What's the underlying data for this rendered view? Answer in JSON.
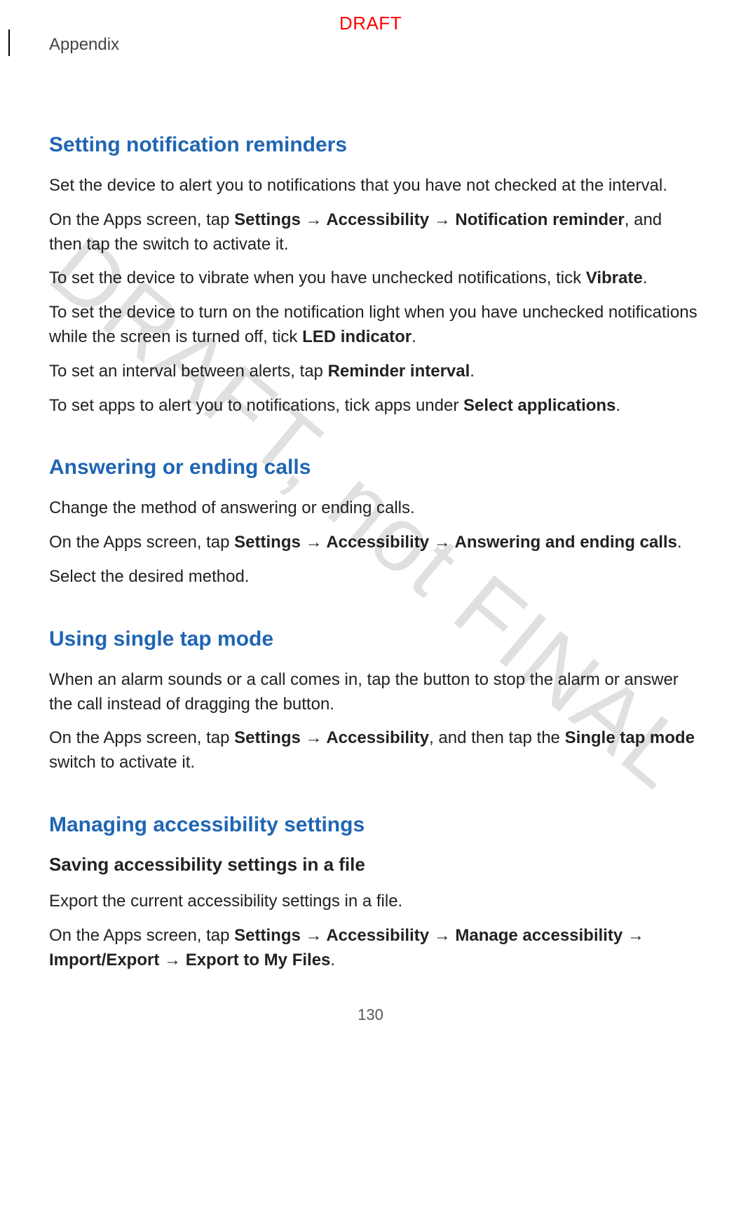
{
  "header": {
    "section": "Appendix",
    "draft": "DRAFT"
  },
  "watermark": "DRAFT, not FINAL",
  "pageNumber": "130",
  "sections": [
    {
      "heading": "Setting notification reminders",
      "paragraphs": [
        {
          "runs": [
            {
              "t": "Set the device to alert you to notifications that you have not checked at the interval."
            }
          ]
        },
        {
          "runs": [
            {
              "t": "On the Apps screen, tap "
            },
            {
              "t": "Settings",
              "b": true
            },
            {
              "t": " → ",
              "arrow": true
            },
            {
              "t": "Accessibility",
              "b": true
            },
            {
              "t": " → ",
              "arrow": true
            },
            {
              "t": "Notification reminder",
              "b": true
            },
            {
              "t": ", and then tap the switch to activate it."
            }
          ]
        },
        {
          "runs": [
            {
              "t": "To set the device to vibrate when you have unchecked notifications, tick "
            },
            {
              "t": "Vibrate",
              "b": true
            },
            {
              "t": "."
            }
          ]
        },
        {
          "runs": [
            {
              "t": "To set the device to turn on the notification light when you have unchecked notifications while the screen is turned off, tick "
            },
            {
              "t": "LED indicator",
              "b": true
            },
            {
              "t": "."
            }
          ]
        },
        {
          "runs": [
            {
              "t": "To set an interval between alerts, tap "
            },
            {
              "t": "Reminder interval",
              "b": true
            },
            {
              "t": "."
            }
          ]
        },
        {
          "runs": [
            {
              "t": "To set apps to alert you to notifications, tick apps under "
            },
            {
              "t": "Select applications",
              "b": true
            },
            {
              "t": "."
            }
          ]
        }
      ]
    },
    {
      "heading": "Answering or ending calls",
      "paragraphs": [
        {
          "runs": [
            {
              "t": "Change the method of answering or ending calls."
            }
          ]
        },
        {
          "runs": [
            {
              "t": "On the Apps screen, tap "
            },
            {
              "t": "Settings",
              "b": true
            },
            {
              "t": " → ",
              "arrow": true
            },
            {
              "t": "Accessibility",
              "b": true
            },
            {
              "t": " → ",
              "arrow": true
            },
            {
              "t": "Answering and ending calls",
              "b": true
            },
            {
              "t": "."
            }
          ]
        },
        {
          "runs": [
            {
              "t": "Select the desired method."
            }
          ]
        }
      ]
    },
    {
      "heading": "Using single tap mode",
      "paragraphs": [
        {
          "runs": [
            {
              "t": "When an alarm sounds or a call comes in, tap the button to stop the alarm or answer the call instead of dragging the button."
            }
          ]
        },
        {
          "runs": [
            {
              "t": "On the Apps screen, tap "
            },
            {
              "t": "Settings",
              "b": true
            },
            {
              "t": " → ",
              "arrow": true
            },
            {
              "t": "Accessibility",
              "b": true
            },
            {
              "t": ", and then tap the "
            },
            {
              "t": "Single tap mode",
              "b": true
            },
            {
              "t": " switch to activate it."
            }
          ]
        }
      ]
    },
    {
      "heading": "Managing accessibility settings",
      "subheading": "Saving accessibility settings in a file",
      "paragraphs": [
        {
          "runs": [
            {
              "t": "Export the current accessibility settings in a file."
            }
          ]
        },
        {
          "runs": [
            {
              "t": "On the Apps screen, tap "
            },
            {
              "t": "Settings",
              "b": true
            },
            {
              "t": " → ",
              "arrow": true
            },
            {
              "t": "Accessibility",
              "b": true
            },
            {
              "t": " → ",
              "arrow": true
            },
            {
              "t": "Manage accessibility",
              "b": true
            },
            {
              "t": " → ",
              "arrow": true
            },
            {
              "t": "Import/Export",
              "b": true
            },
            {
              "t": " → ",
              "arrow": true
            },
            {
              "t": "Export to My Files",
              "b": true
            },
            {
              "t": "."
            }
          ]
        }
      ]
    }
  ]
}
